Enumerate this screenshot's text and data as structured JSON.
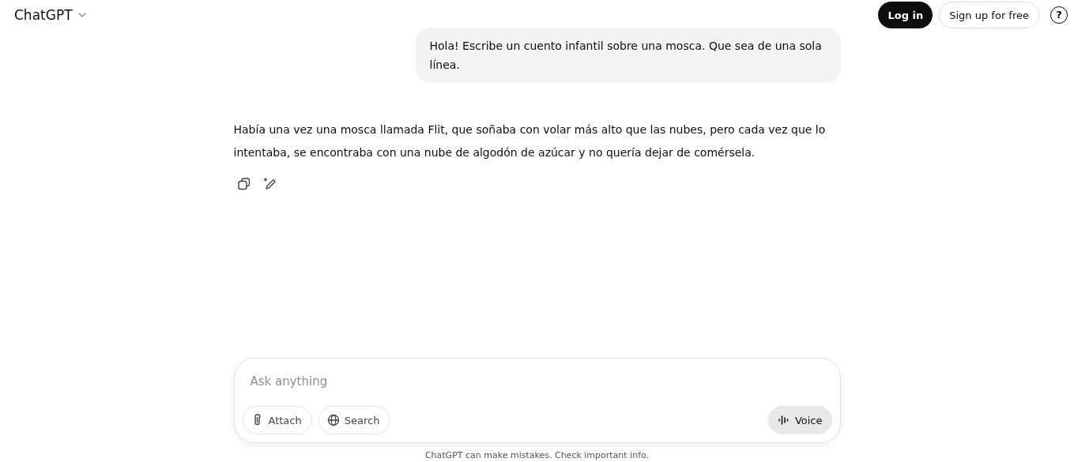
{
  "header": {
    "model_name": "ChatGPT",
    "login_button": "Log in",
    "signup_button": "Sign up for free",
    "help_icon": "?"
  },
  "messages": [
    {
      "kind": "user",
      "text": "Hola! Escribe un cuento infantil sobre una mosca. Que sea de una sola línea."
    },
    {
      "kind": "assistant",
      "text": "Había una vez una mosca llamada Flit, que soñaba con volar más alto que las nubes, pero cada vez que lo intentaba, se encontraba con una nube de algodón de azúcar y no quería dejar de comérsela."
    }
  ],
  "composer": {
    "placeholder": "Ask anything",
    "buttons": [
      {
        "kind": "attach",
        "label": "Attach"
      },
      {
        "kind": "search",
        "label": "Search"
      }
    ],
    "voice_button": "Voice"
  },
  "disclaimer": "ChatGPT can make mistakes. Check important info."
}
